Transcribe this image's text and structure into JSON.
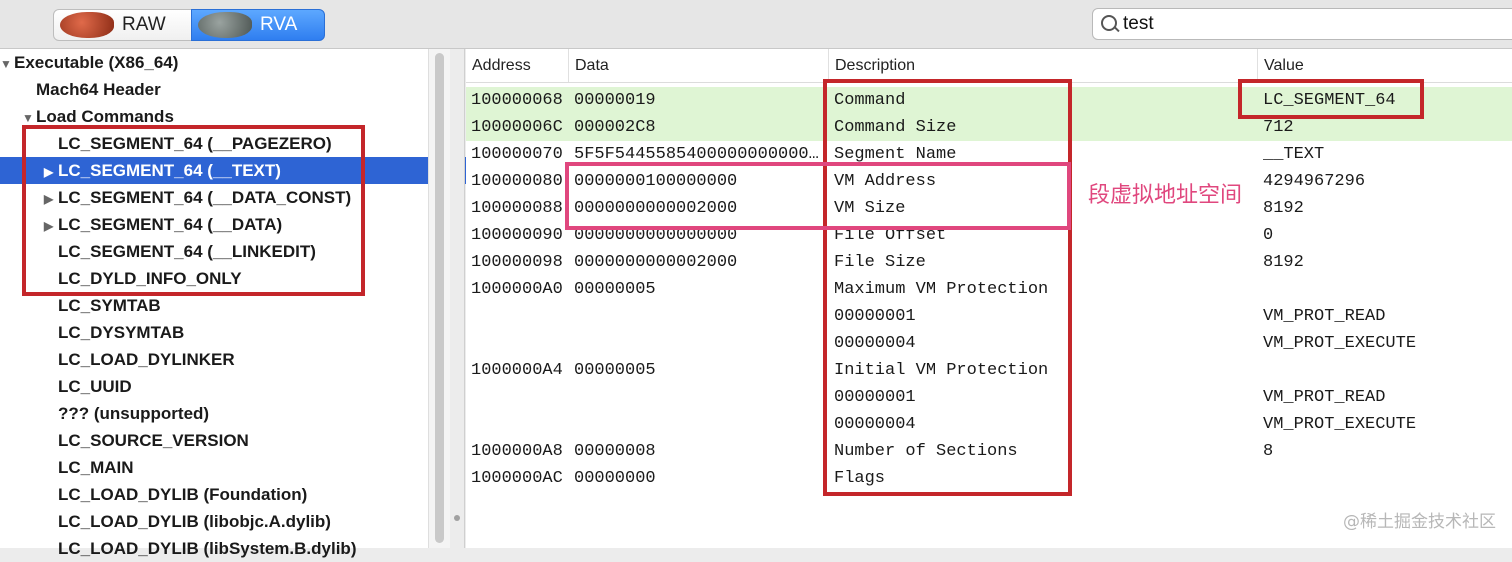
{
  "toolbar": {
    "raw_label": "RAW",
    "rva_label": "RVA",
    "search_value": "test"
  },
  "tree": [
    {
      "label": "Executable  (X86_64)",
      "level": 0,
      "arrow": "▼",
      "selected": false
    },
    {
      "label": "Mach64 Header",
      "level": 1,
      "arrow": "",
      "selected": false
    },
    {
      "label": "Load Commands",
      "level": 1,
      "arrow": "▼",
      "selected": false
    },
    {
      "label": "LC_SEGMENT_64 (__PAGEZERO)",
      "level": 2,
      "arrow": "",
      "selected": false
    },
    {
      "label": "LC_SEGMENT_64 (__TEXT)",
      "level": 2,
      "arrow": "▶",
      "selected": true
    },
    {
      "label": "LC_SEGMENT_64 (__DATA_CONST)",
      "level": 2,
      "arrow": "▶",
      "selected": false
    },
    {
      "label": "LC_SEGMENT_64 (__DATA)",
      "level": 2,
      "arrow": "▶",
      "selected": false
    },
    {
      "label": "LC_SEGMENT_64 (__LINKEDIT)",
      "level": 2,
      "arrow": "",
      "selected": false
    },
    {
      "label": "LC_DYLD_INFO_ONLY",
      "level": 2,
      "arrow": "",
      "selected": false
    },
    {
      "label": "LC_SYMTAB",
      "level": 2,
      "arrow": "",
      "selected": false
    },
    {
      "label": "LC_DYSYMTAB",
      "level": 2,
      "arrow": "",
      "selected": false
    },
    {
      "label": "LC_LOAD_DYLINKER",
      "level": 2,
      "arrow": "",
      "selected": false
    },
    {
      "label": "LC_UUID",
      "level": 2,
      "arrow": "",
      "selected": false
    },
    {
      "label": "??? (unsupported)",
      "level": 2,
      "arrow": "",
      "selected": false
    },
    {
      "label": "LC_SOURCE_VERSION",
      "level": 2,
      "arrow": "",
      "selected": false
    },
    {
      "label": "LC_MAIN",
      "level": 2,
      "arrow": "",
      "selected": false
    },
    {
      "label": "LC_LOAD_DYLIB (Foundation)",
      "level": 2,
      "arrow": "",
      "selected": false
    },
    {
      "label": "LC_LOAD_DYLIB (libobjc.A.dylib)",
      "level": 2,
      "arrow": "",
      "selected": false
    },
    {
      "label": "LC_LOAD_DYLIB (libSystem.B.dylib)",
      "level": 2,
      "arrow": "",
      "selected": false
    }
  ],
  "table": {
    "headers": [
      "Address",
      "Data",
      "Description",
      "Value"
    ],
    "rows": [
      {
        "address": "100000068",
        "data": "00000019",
        "description": "Command",
        "value": "LC_SEGMENT_64",
        "highlight": true
      },
      {
        "address": "10000006C",
        "data": "000002C8",
        "description": "Command Size",
        "value": "712",
        "highlight": true
      },
      {
        "address": "100000070",
        "data": "5F5F5445585400000000000…",
        "description": "Segment Name",
        "value": "__TEXT",
        "highlight": false
      },
      {
        "address": "100000080",
        "data": "0000000100000000",
        "description": "VM Address",
        "value": "4294967296",
        "highlight": false
      },
      {
        "address": "100000088",
        "data": "0000000000002000",
        "description": "VM Size",
        "value": "8192",
        "highlight": false
      },
      {
        "address": "100000090",
        "data": "0000000000000000",
        "description": "File Offset",
        "value": "0",
        "highlight": false
      },
      {
        "address": "100000098",
        "data": "0000000000002000",
        "description": "File Size",
        "value": "8192",
        "highlight": false
      },
      {
        "address": "1000000A0",
        "data": "00000005",
        "description": "Maximum VM Protection",
        "value": "",
        "highlight": false
      },
      {
        "address": "",
        "data": "",
        "description": "00000001",
        "value": "VM_PROT_READ",
        "highlight": false
      },
      {
        "address": "",
        "data": "",
        "description": "00000004",
        "value": "VM_PROT_EXECUTE",
        "highlight": false
      },
      {
        "address": "1000000A4",
        "data": "00000005",
        "description": "Initial VM Protection",
        "value": "",
        "highlight": false
      },
      {
        "address": "",
        "data": "",
        "description": "00000001",
        "value": "VM_PROT_READ",
        "highlight": false
      },
      {
        "address": "",
        "data": "",
        "description": "00000004",
        "value": "VM_PROT_EXECUTE",
        "highlight": false
      },
      {
        "address": "1000000A8",
        "data": "00000008",
        "description": "Number of Sections",
        "value": "8",
        "highlight": false
      },
      {
        "address": "1000000AC",
        "data": "00000000",
        "description": "Flags",
        "value": "",
        "highlight": false
      }
    ]
  },
  "annotation": "段虚拟地址空间",
  "watermark": "@稀土掘金技术社区",
  "colors": {
    "selection": "#2e64d4",
    "highlight_row": "#dff5d4",
    "box_red": "#c4262a",
    "box_pink": "#e0477e"
  }
}
